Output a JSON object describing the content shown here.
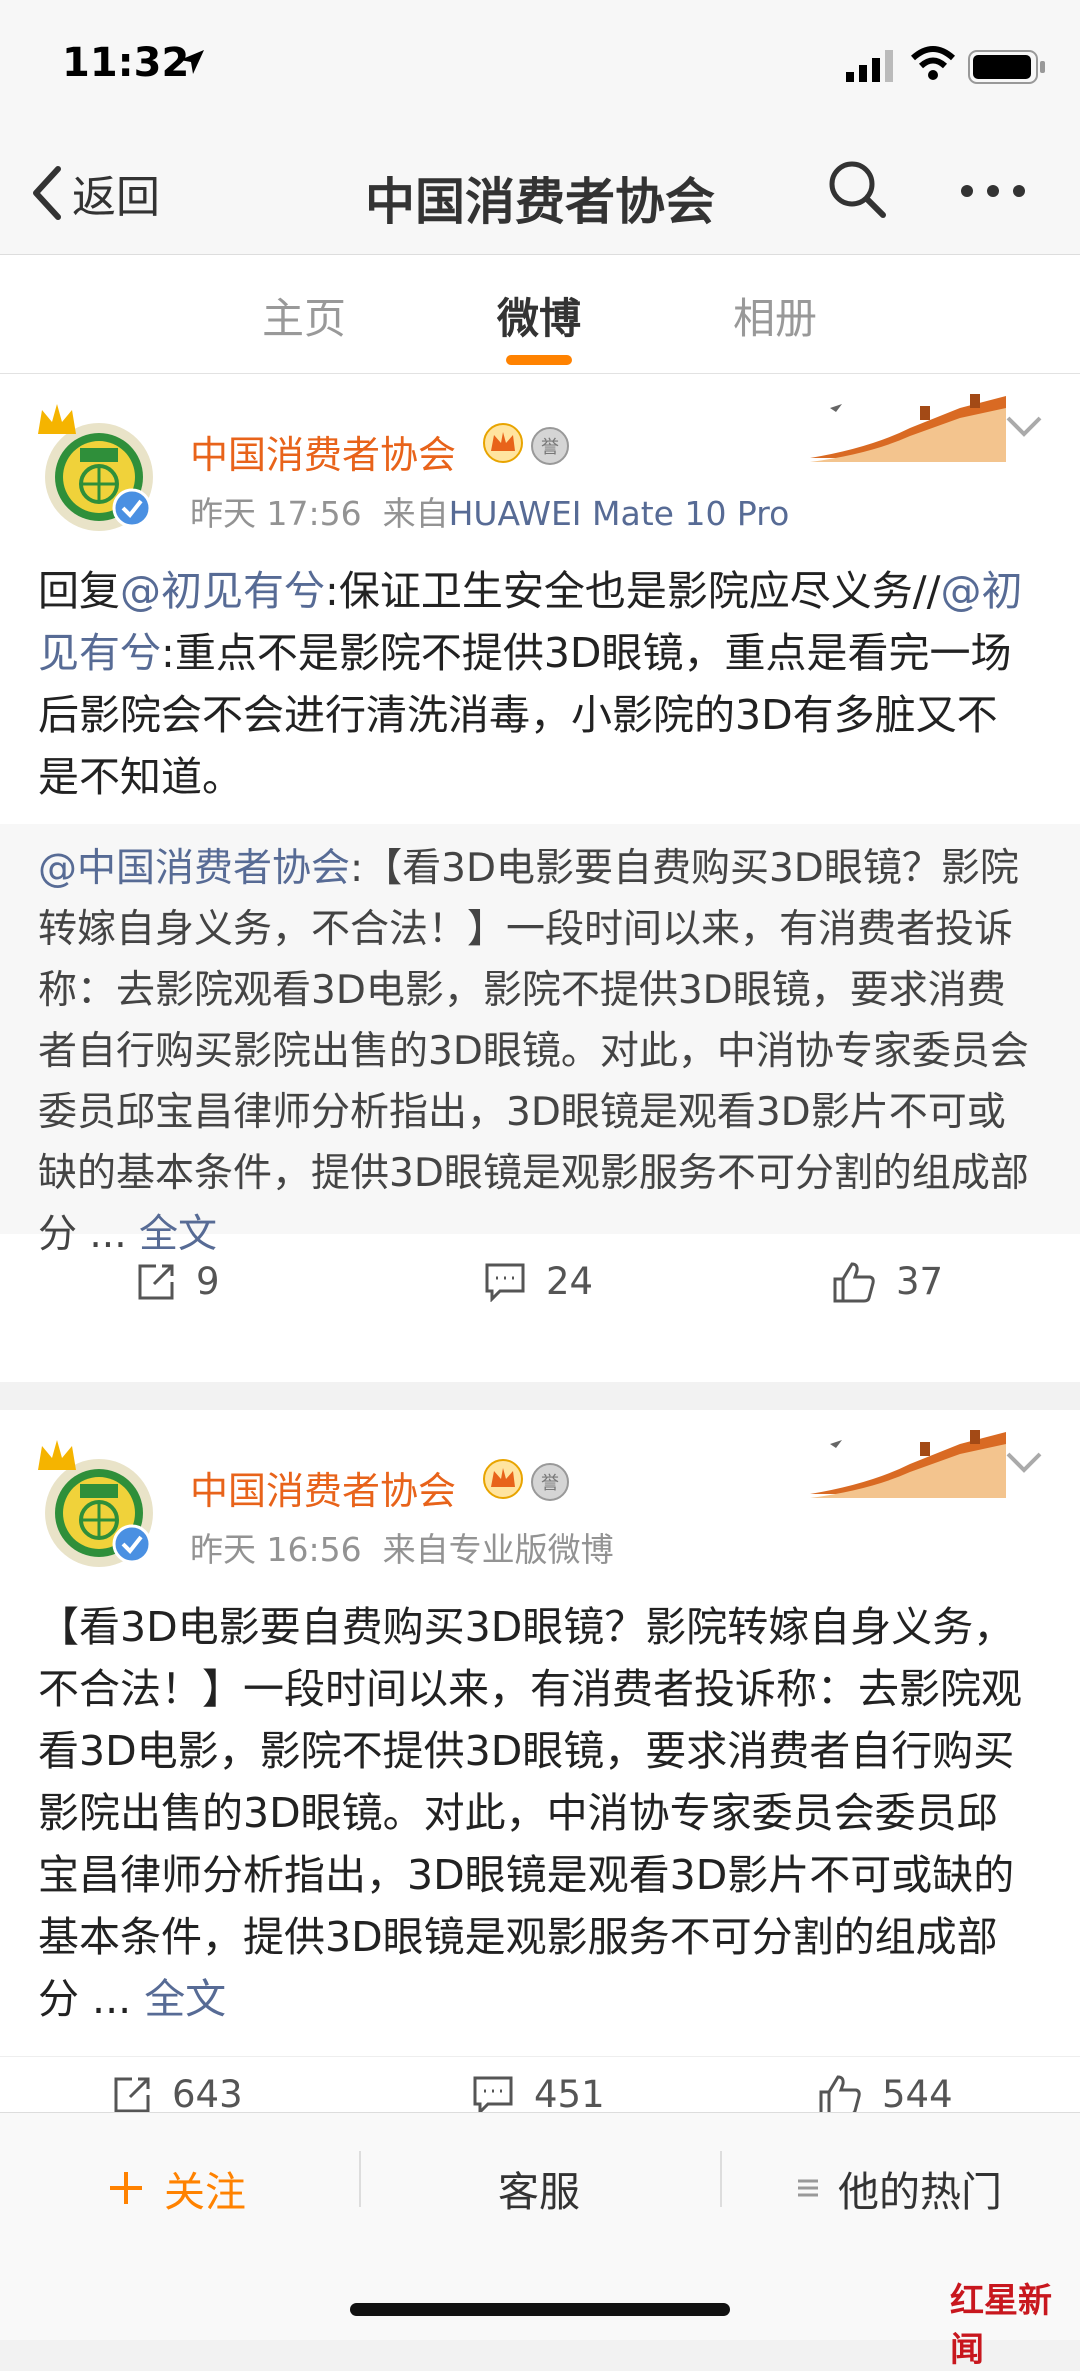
{
  "status": {
    "time": "11:32"
  },
  "nav": {
    "back": "返回",
    "title": "中国消费者协会"
  },
  "tabs": [
    {
      "label": "主页"
    },
    {
      "label": "微博"
    },
    {
      "label": "相册"
    }
  ],
  "posts": [
    {
      "author": "中国消费者协会",
      "time": "昨天 17:56",
      "source_prefix": "来自",
      "device": "HUAWEI Mate 10 Pro",
      "text_reply": "回复",
      "text_mention1": "@初见有兮",
      "text_part1": ":保证卫生安全也是影院应尽义务//",
      "text_mention2": "@初见有兮",
      "text_part2": ":重点不是影院不提供3D眼镜，重点是看完一场后影院会不会进行清洗消毒，小影院的3D有多脏又不是不知道。",
      "retweet_mention": "@中国消费者协会",
      "retweet_text": ":【看3D电影要自费购买3D眼镜？影院转嫁自身义务，不合法！】一段时间以来，有消费者投诉称：去影院观看3D电影，影院不提供3D眼镜，要求消费者自行购买影院出售的3D眼镜。对此，中消协专家委员会委员邱宝昌律师分析指出，3D眼镜是观看3D影片不可或缺的基本条件，提供3D眼镜是观影服务不可分割的组成部分 ...",
      "more": "全文",
      "reposts": "9",
      "comments": "24",
      "likes": "37"
    },
    {
      "author": "中国消费者协会",
      "time": "昨天 16:56",
      "source": "来自专业版微博",
      "text": "【看3D电影要自费购买3D眼镜？影院转嫁自身义务，不合法！】一段时间以来，有消费者投诉称：去影院观看3D电影，影院不提供3D眼镜，要求消费者自行购买影院出售的3D眼镜。对此，中消协专家委员会委员邱宝昌律师分析指出，3D眼镜是观看3D影片不可或缺的基本条件，提供3D眼镜是观影服务不可分割的组成部分 ...",
      "more": "全文",
      "reposts": "643",
      "comments": "451",
      "likes": "544"
    }
  ],
  "bottom": {
    "follow": "关注",
    "service": "客服",
    "hot": "他的热门"
  },
  "watermark": "红星新闻",
  "colors": {
    "accent": "#ff8200",
    "link": "#576b95",
    "author": "#e8631a"
  }
}
